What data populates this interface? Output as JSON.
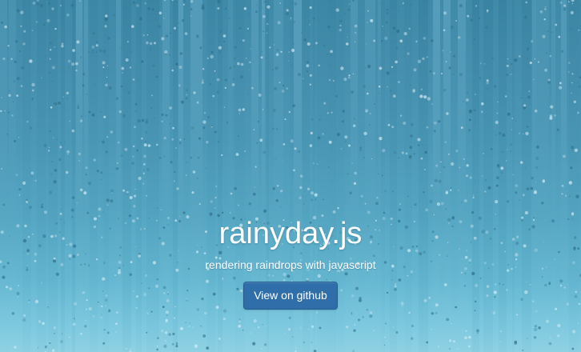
{
  "hero": {
    "title": "rainyday.js",
    "subtitle": "rendering raindrops with javascript",
    "button_label": "View on github"
  },
  "colors": {
    "background_top": "#3f8aa8",
    "background_bottom": "#8fd1e3",
    "button": "#2f6ea8",
    "text": "#ffffff"
  }
}
